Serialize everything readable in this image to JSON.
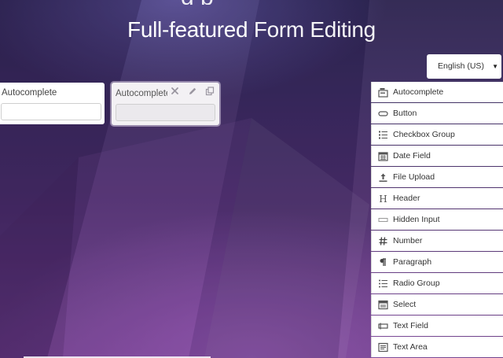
{
  "header": {
    "title_partial": "g p",
    "title_strong": "Full-featured",
    "title_light": "Form Editing"
  },
  "language": {
    "selected": "English (US)"
  },
  "stage": {
    "fields": [
      {
        "label": "Autocomplete"
      },
      {
        "label": "Autocomplete"
      }
    ],
    "actions": {
      "remove_icon": "close-icon",
      "edit_icon": "pencil-icon",
      "copy_icon": "copy-icon"
    }
  },
  "palette": {
    "items": [
      {
        "label": "Autocomplete",
        "icon": "autocomplete-icon"
      },
      {
        "label": "Button",
        "icon": "button-icon"
      },
      {
        "label": "Checkbox Group",
        "icon": "checkbox-group-icon"
      },
      {
        "label": "Date Field",
        "icon": "calendar-icon"
      },
      {
        "label": "File Upload",
        "icon": "upload-icon"
      },
      {
        "label": "Header",
        "icon": "header-icon"
      },
      {
        "label": "Hidden Input",
        "icon": "hidden-input-icon"
      },
      {
        "label": "Number",
        "icon": "hash-icon"
      },
      {
        "label": "Paragraph",
        "icon": "paragraph-icon"
      },
      {
        "label": "Radio Group",
        "icon": "radio-group-icon"
      },
      {
        "label": "Select",
        "icon": "select-icon"
      },
      {
        "label": "Text Field",
        "icon": "text-field-icon"
      },
      {
        "label": "Text Area",
        "icon": "text-area-icon"
      }
    ]
  },
  "colors": {
    "background_top": "#2d2450",
    "background_bottom": "#6a3a86",
    "card": "#ffffff",
    "selected_card": "#f3f1f4"
  }
}
